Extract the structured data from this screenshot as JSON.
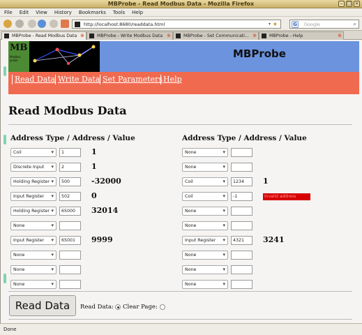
{
  "window": {
    "title": "MBProbe - Read Modbus Data - Mozilla Firefox"
  },
  "menubar": [
    "File",
    "Edit",
    "View",
    "History",
    "Bookmarks",
    "Tools",
    "Help"
  ],
  "toolbar": {
    "url": "http://localhost:8680/readdata.html",
    "search_placeholder": "Google"
  },
  "tabs": [
    {
      "label": "MBProbe - Read Modbus Data",
      "active": true
    },
    {
      "label": "MBProbe - Write Modbus Data",
      "active": false
    },
    {
      "label": "MBProbe - Set Communicati...",
      "active": false
    },
    {
      "label": "MBProbe - Help",
      "active": false
    }
  ],
  "header": {
    "logo_text": "MB",
    "logo_sub": "Modbus probe",
    "app_title": "MBProbe"
  },
  "nav": [
    "Read Data",
    "Write Data",
    "Set Parameters",
    "Help"
  ],
  "page": {
    "heading": "Read Modbus Data",
    "column_heading": "Address Type / Address / Value"
  },
  "left_rows": [
    {
      "type": "Coil",
      "address": "1",
      "value": "1"
    },
    {
      "type": "Discrete Input",
      "address": "2",
      "value": "1"
    },
    {
      "type": "Holding Register",
      "address": "500",
      "value": "-32000"
    },
    {
      "type": "Input Register",
      "address": "502",
      "value": "0"
    },
    {
      "type": "Holding Register",
      "address": "65000",
      "value": "32014"
    },
    {
      "type": "None",
      "address": "",
      "value": ""
    },
    {
      "type": "Input Register",
      "address": "65001",
      "value": "9999"
    },
    {
      "type": "None",
      "address": "",
      "value": ""
    },
    {
      "type": "None",
      "address": "",
      "value": ""
    },
    {
      "type": "None",
      "address": "",
      "value": ""
    }
  ],
  "right_rows": [
    {
      "type": "None",
      "address": "",
      "value": ""
    },
    {
      "type": "None",
      "address": "",
      "value": ""
    },
    {
      "type": "Coil",
      "address": "1234",
      "value": "1"
    },
    {
      "type": "Coil",
      "address": "-1",
      "value": "",
      "error": "Invalid address"
    },
    {
      "type": "None",
      "address": "",
      "value": ""
    },
    {
      "type": "None",
      "address": "",
      "value": ""
    },
    {
      "type": "Input Register",
      "address": "4321",
      "value": "3241"
    },
    {
      "type": "None",
      "address": "",
      "value": ""
    },
    {
      "type": "None",
      "address": "",
      "value": ""
    },
    {
      "type": "None",
      "address": "",
      "value": ""
    }
  ],
  "form": {
    "submit_label": "Read Data",
    "option_read": "Read Data:",
    "option_clear": "Clear Page:",
    "selected_option": "read"
  },
  "status": "Done",
  "colors": {
    "header_bg": "#6b93de",
    "nav_bg": "#f06a50",
    "error_bg": "#d60000"
  }
}
